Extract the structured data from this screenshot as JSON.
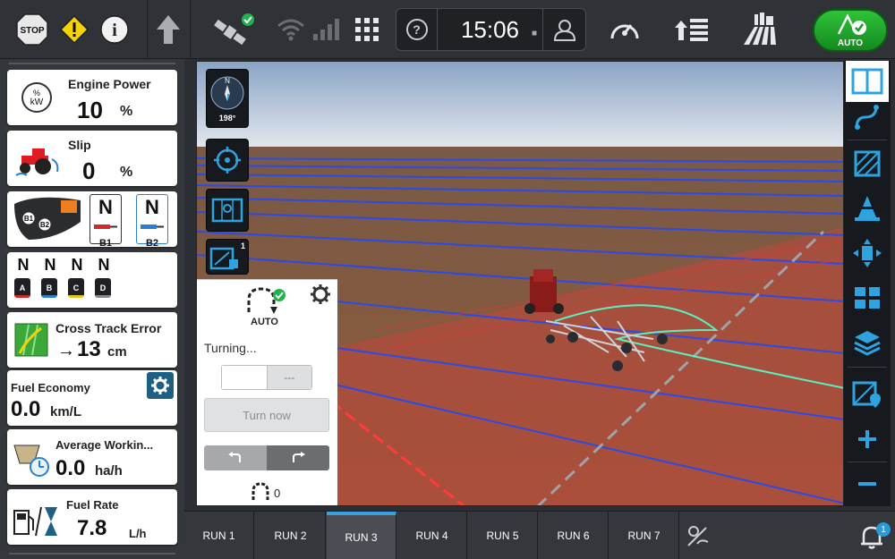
{
  "topbar": {
    "stop_label": "STOP",
    "clock_time": "15:06",
    "auto_label": "AUTO"
  },
  "tiles": {
    "engine_power": {
      "title": "Engine Power",
      "value": "10",
      "unit": "%",
      "icon_label": "% kW"
    },
    "slip": {
      "title": "Slip",
      "value": "0",
      "unit": "%"
    },
    "hitch": {
      "b1_state": "N",
      "b1_label": "B1",
      "b2_state": "N",
      "b2_label": "B2",
      "icon_b1": "B1",
      "icon_b2": "B2"
    },
    "remotes": [
      {
        "state": "N",
        "label": "A"
      },
      {
        "state": "N",
        "label": "B"
      },
      {
        "state": "N",
        "label": "C"
      },
      {
        "state": "N",
        "label": "D"
      }
    ],
    "cross_track": {
      "title": "Cross Track Error",
      "value": "13",
      "unit": "cm",
      "arrow": "→"
    },
    "fuel_economy": {
      "title": "Fuel Economy",
      "value": "0.0",
      "unit": "km/L"
    },
    "avg_working": {
      "title": "Average Workin...",
      "value": "0.0",
      "unit": "ha/h"
    },
    "fuel_rate": {
      "title": "Fuel Rate",
      "value": "7.8",
      "unit": "L/h"
    }
  },
  "compass": {
    "heading": "198°",
    "north": "N"
  },
  "turn_panel": {
    "mode_label": "AUTO",
    "status": "Turning...",
    "seg_right": "---",
    "turn_now_label": "Turn now",
    "count": "0"
  },
  "left_tools": {
    "badge": "1"
  },
  "runs": [
    "RUN 1",
    "RUN 2",
    "RUN 3",
    "RUN 4",
    "RUN 5",
    "RUN 6",
    "RUN 7"
  ],
  "active_run": "RUN 3",
  "notifications": {
    "count": "1"
  },
  "colors": {
    "accent_blue": "#2fa3e0",
    "guidance_blue": "#2a4be8",
    "headland_red": "#d93a3a",
    "auto_green": "#22aa2c"
  }
}
